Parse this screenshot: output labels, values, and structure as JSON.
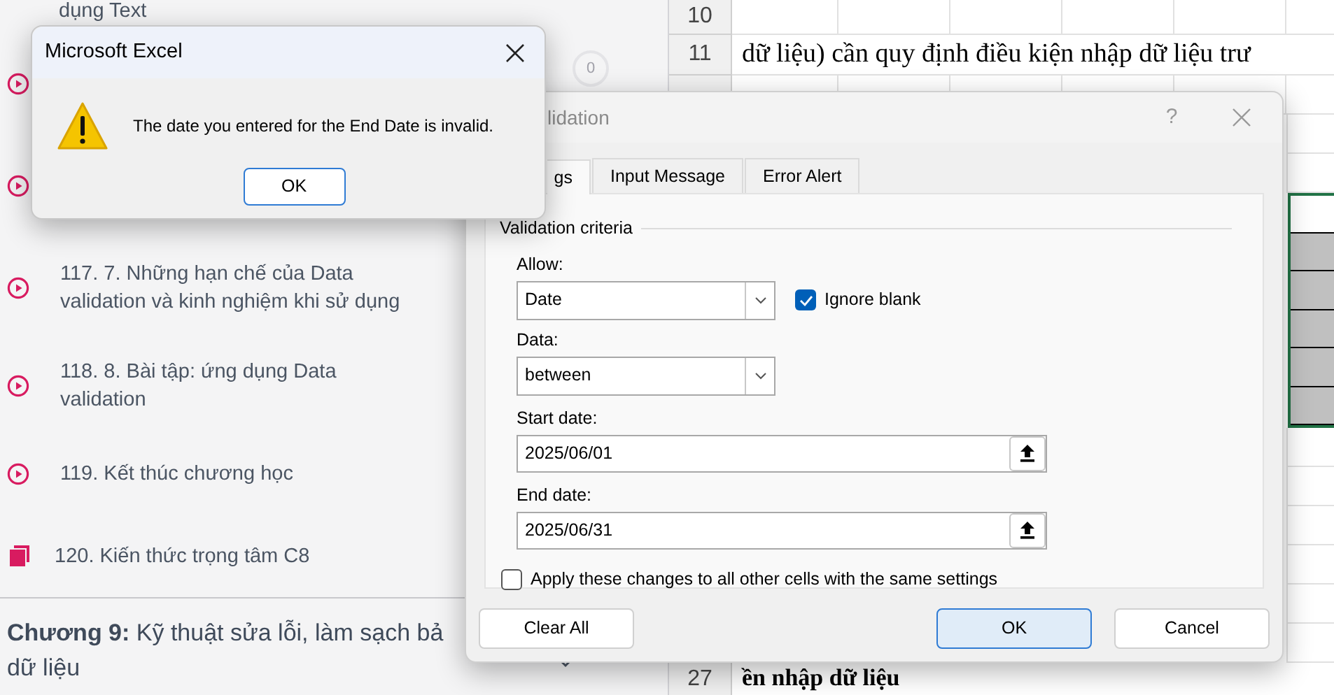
{
  "sidebar": {
    "cut_text": "dụng Text",
    "lessons": [
      {
        "kind": "video",
        "progress": "0"
      },
      {
        "kind": "video"
      },
      {
        "kind": "video",
        "title": "117. 7. Những hạn chế của Data validation và kinh nghiệm khi sử dụng"
      },
      {
        "kind": "video",
        "title": "118. 8. Bài tập: ứng dụng Data validation"
      },
      {
        "kind": "video",
        "title": "119. Kết thúc chương học"
      },
      {
        "kind": "document",
        "title": "120. Kiến thức trọng tâm C8"
      }
    ],
    "chapter": {
      "lines": [
        "**Chương 9:** Kỹ thuật sửa lỗi, làm sạch bả",
        "dữ liệu"
      ],
      "expanded": false
    }
  },
  "sheet": {
    "rows": [
      {
        "number": "10"
      },
      {
        "number": "11",
        "text": "dữ liệu) cần quy định điều kiện nhập dữ liệu trư"
      },
      {
        "number": "27",
        "text": "ền nhập dữ liệu"
      }
    ]
  },
  "validation_dialog": {
    "title": "lidation",
    "help": "?",
    "tabs": [
      {
        "label": "gs",
        "selected": true
      },
      {
        "label": "Input Message",
        "selected": false
      },
      {
        "label": "Error Alert",
        "selected": false
      }
    ],
    "group": "Validation criteria",
    "allow": {
      "label": "Allow:",
      "value": "Date"
    },
    "ignore_blank": {
      "label": "Ignore blank",
      "checked": true
    },
    "data": {
      "label": "Data:",
      "value": "between"
    },
    "start_date": {
      "label": "Start date:",
      "value": "2025/06/01"
    },
    "end_date": {
      "label": "End date:",
      "value": "2025/06/31"
    },
    "apply_all": {
      "label": "Apply these changes to all other cells with the same settings",
      "checked": false
    },
    "buttons": [
      {
        "label": "Clear All",
        "kind": "left"
      },
      {
        "label": "OK",
        "kind": "default"
      },
      {
        "label": "Cancel",
        "kind": "normal"
      }
    ]
  },
  "message_box": {
    "title": "Microsoft Excel",
    "message": "The date you entered for the End Date is invalid.",
    "button": "OK"
  }
}
